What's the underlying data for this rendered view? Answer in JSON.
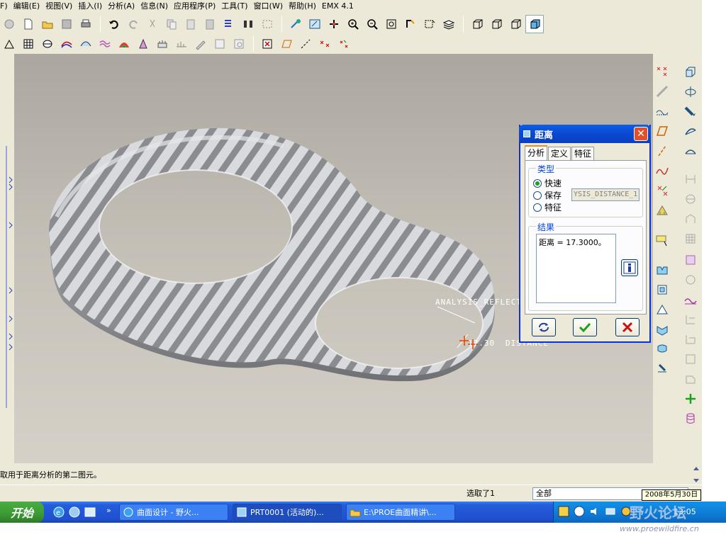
{
  "menu": [
    "F)",
    "编辑(E)",
    "视图(V)",
    "插入(I)",
    "分析(A)",
    "信息(N)",
    "应用程序(P)",
    "工具(T)",
    "窗口(W)",
    "帮助(H)",
    "EMX 4.1"
  ],
  "viewport": {
    "label_reflect": "ANALYSIS_REFLECT",
    "label_value": "17.30",
    "label_distance": "DISTANCE"
  },
  "dialog": {
    "title": "距离",
    "tabs": [
      "分析",
      "定义",
      "特征"
    ],
    "type_group": "类型",
    "options": [
      "快速",
      "保存",
      "特征"
    ],
    "selected_option": "快速",
    "name_field_value": "YSIS_DISTANCE_1",
    "result_group": "结果",
    "result_text": "距离  =  17.3000。"
  },
  "status": {
    "message": "取用于距离分析的第二图元。",
    "selected_count": "选取了1",
    "filter": "全部"
  },
  "taskbar": {
    "start": "开始",
    "tasks": [
      "曲面设计 - 野火...",
      "PRT0001 (活动的)...",
      "E:\\PROE曲面精讲\\..."
    ],
    "clock": "13:05",
    "date_tooltip": "2008年5月30日"
  },
  "watermark": {
    "site": "www.proewildfire.cn",
    "name": "野火论坛"
  },
  "colors": {
    "accent": "#0a4bd6",
    "taskbar": "#245edb",
    "start": "#3c9a34",
    "stripe_dark": "#8b8c90",
    "stripe_light": "#d8dadd"
  }
}
